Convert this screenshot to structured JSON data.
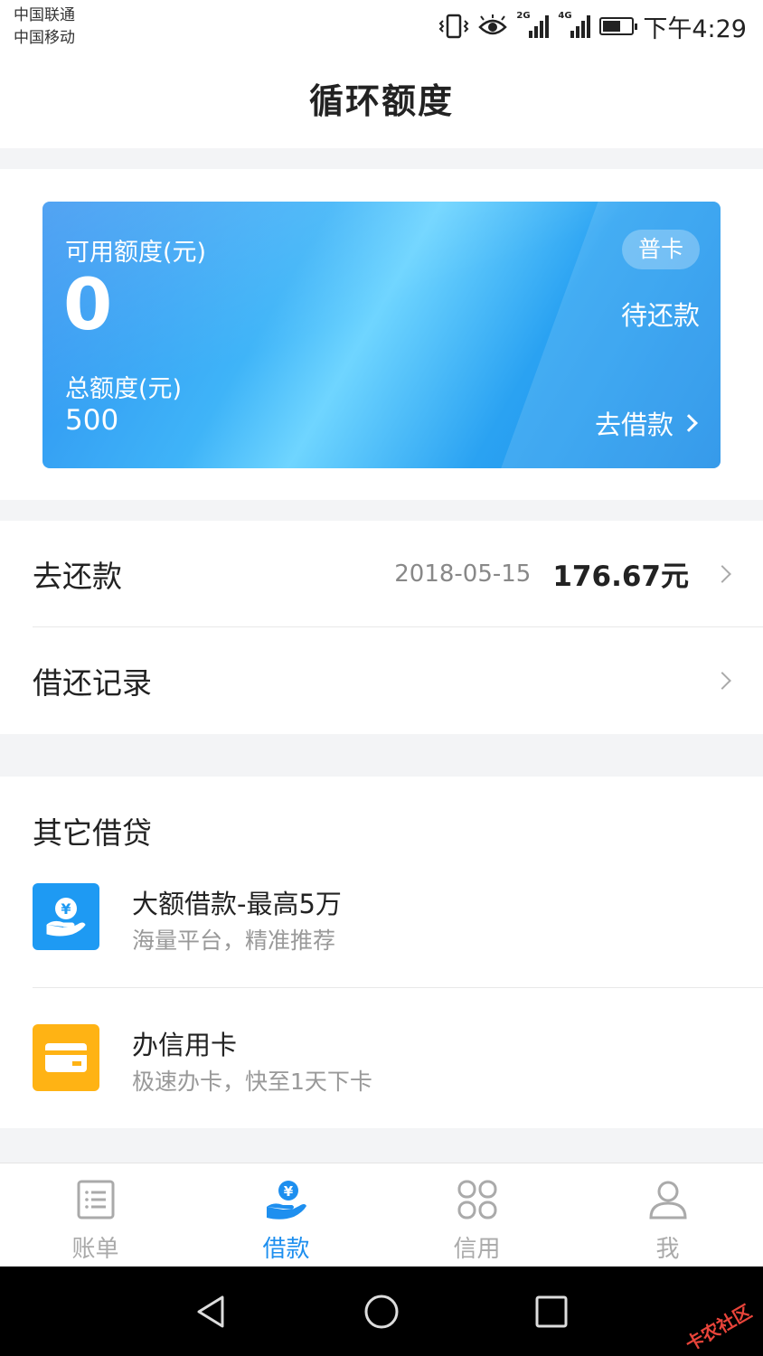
{
  "status_bar": {
    "carrier_1": "中国联通",
    "carrier_2": "中国移动",
    "net_1": "2G",
    "net_2": "4G",
    "time": "下午4:29"
  },
  "header": {
    "title": "循环额度"
  },
  "credit_card": {
    "available_label": "可用额度(元)",
    "available_value": "0",
    "total_label": "总额度(元)",
    "total_value": "500",
    "card_type": "普卡",
    "status": "待还款",
    "borrow_link": "去借款"
  },
  "repay": {
    "label": "去还款",
    "date": "2018-05-15",
    "amount": "176.67元"
  },
  "records": {
    "label": "借还记录"
  },
  "other_loans": {
    "title": "其它借贷",
    "items": [
      {
        "title": "大额借款-最高5万",
        "subtitle": "海量平台，精准推荐",
        "icon": "yuan-hand-icon",
        "color": "#1e9af3"
      },
      {
        "title": "办信用卡",
        "subtitle": "极速办卡，快至1天下卡",
        "icon": "card-icon",
        "color": "#ffb314"
      }
    ]
  },
  "tabs": [
    {
      "label": "账单",
      "icon": "bill-icon",
      "active": false
    },
    {
      "label": "借款",
      "icon": "loan-icon",
      "active": true
    },
    {
      "label": "信用",
      "icon": "credit-grid-icon",
      "active": false
    },
    {
      "label": "我",
      "icon": "user-icon",
      "active": false
    }
  ],
  "watermark": "卡农社区",
  "colors": {
    "accent": "#1e8fef",
    "inactive": "#aaaaaa",
    "yellow": "#ffb314"
  }
}
